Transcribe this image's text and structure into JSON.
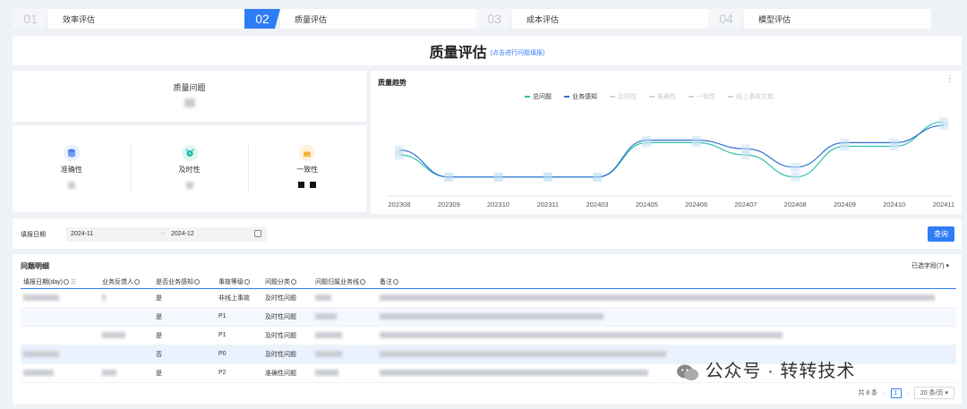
{
  "steps": [
    {
      "num": "01",
      "label": "效率评估",
      "active": false
    },
    {
      "num": "02",
      "label": "质量评估",
      "active": true
    },
    {
      "num": "03",
      "label": "成本评估",
      "active": false
    },
    {
      "num": "04",
      "label": "模型评估",
      "active": false
    }
  ],
  "header": {
    "title": "质量评估",
    "link": "(点击进行问题填报)"
  },
  "issues_card": {
    "title": "质量问题"
  },
  "metrics": [
    {
      "label": "准确性",
      "icon": "database-icon",
      "color": "#4a7cf0",
      "bg": "#e6eeff"
    },
    {
      "label": "及时性",
      "icon": "alarm-clock-icon",
      "color": "#1fb8a8",
      "bg": "#dff7f3"
    },
    {
      "label": "一致性",
      "icon": "crown-icon",
      "color": "#f5a623",
      "bg": "#fff2dc"
    }
  ],
  "chart": {
    "title": "质量趋势",
    "legend": [
      {
        "name": "总问题",
        "color": "#2bc0ac",
        "active": true
      },
      {
        "name": "业务感知",
        "color": "#2b6fd6",
        "active": true
      },
      {
        "name": "及时性",
        "color": "#cfd3da",
        "active": false
      },
      {
        "name": "准确性",
        "color": "#cfd3da",
        "active": false
      },
      {
        "name": "一致性",
        "color": "#cfd3da",
        "active": false
      },
      {
        "name": "线上事故次数",
        "color": "#cfd3da",
        "active": false
      }
    ]
  },
  "chart_data": {
    "type": "line",
    "categories": [
      "202308",
      "202309",
      "202310",
      "202311",
      "202403",
      "202405",
      "202406",
      "202407",
      "202408",
      "202409",
      "202410",
      "202411"
    ],
    "series": [
      {
        "name": "总问题",
        "values": [
          3.2,
          1.4,
          1.4,
          1.4,
          1.4,
          4.2,
          4.2,
          3.2,
          1.4,
          3.9,
          3.9,
          5.9
        ]
      },
      {
        "name": "业务感知",
        "values": [
          3.6,
          1.4,
          1.4,
          1.4,
          1.4,
          4.4,
          4.4,
          3.7,
          2.2,
          4.2,
          4.2,
          5.6
        ]
      }
    ]
  },
  "filter": {
    "label": "填报日期",
    "start": "2024-11",
    "arrow": "→",
    "end": "2024-12",
    "query_button": "查询"
  },
  "table": {
    "title": "问题明细",
    "column_selector": "已选字段(7)",
    "columns": [
      "填报日期(day)",
      "业务反馈人",
      "是否业务感知",
      "事故等级",
      "问题分类",
      "问题归属业务线",
      "备注"
    ],
    "rows": [
      {
        "perceived": "是",
        "level": "非线上事故",
        "category": "及时性问题"
      },
      {
        "perceived": "是",
        "level": "P1",
        "category": "及时性问题"
      },
      {
        "perceived": "是",
        "level": "P1",
        "category": "及时性问题"
      },
      {
        "perceived": "否",
        "level": "P0",
        "category": "及时性问题"
      },
      {
        "perceived": "是",
        "level": "P2",
        "category": "准确性问题"
      }
    ],
    "pager": {
      "total": "共 8 条",
      "page": "1",
      "page_size": "20 条/页"
    }
  },
  "watermark": "公众号 · 转转技术"
}
